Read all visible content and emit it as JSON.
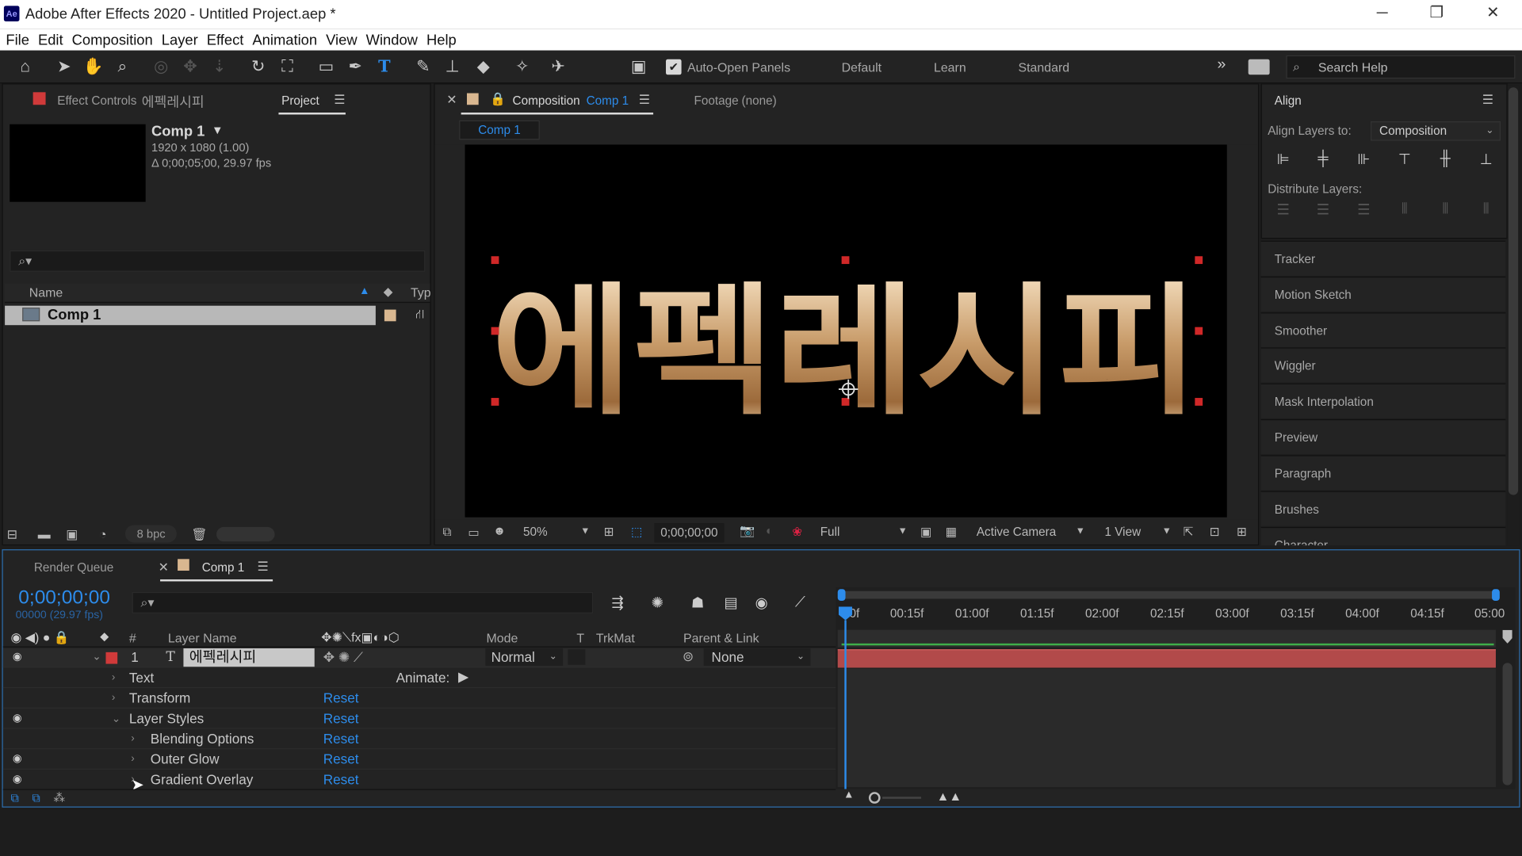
{
  "window": {
    "title": "Adobe After Effects 2020 - Untitled Project.aep *",
    "app_badge": "Ae",
    "minimize": "─",
    "maximize": "❐",
    "close": "✕"
  },
  "menu": [
    "File",
    "Edit",
    "Composition",
    "Layer",
    "Effect",
    "Animation",
    "View",
    "Window",
    "Help"
  ],
  "toolbar": {
    "auto_open": "Auto-Open Panels",
    "workspaces": [
      "Default",
      "Learn",
      "Standard"
    ],
    "more": "»",
    "search_placeholder": "Search Help"
  },
  "left_panel": {
    "tab_effect": "Effect Controls",
    "tab_effect_name": "에펙레시피",
    "tab_project": "Project",
    "comp_name": "Comp 1",
    "comp_size": "1920 x 1080 (1.00)",
    "comp_duration": "Δ 0;00;05;00, 29.97 fps",
    "col_name": "Name",
    "col_type": "Typ",
    "item": "Comp 1",
    "bpc": "8 bpc"
  },
  "viewer": {
    "tab_label": "Composition",
    "tab_comp": "Comp 1",
    "footage": "Footage",
    "footage_val": "(none)",
    "crumb": "Comp 1",
    "text": "에펙레시피",
    "zoom": "50%",
    "timecode": "0;00;00;00",
    "resolution": "Full",
    "camera": "Active Camera",
    "views": "1 View"
  },
  "align": {
    "title": "Align",
    "align_to_label": "Align Layers to:",
    "align_to_value": "Composition",
    "distribute_label": "Distribute Layers:",
    "items": [
      "Tracker",
      "Motion Sketch",
      "Smoother",
      "Wiggler",
      "Mask Interpolation",
      "Preview",
      "Paragraph",
      "Brushes",
      "Character"
    ]
  },
  "timeline": {
    "tab_render": "Render Queue",
    "tab_comp": "Comp 1",
    "timecode": "0;00;00;00",
    "frame_info": "00000 (29.97 fps)",
    "col_num": "#",
    "col_layer": "Layer Name",
    "col_mode": "Mode",
    "col_t": "T",
    "col_trkmat": "TrkMat",
    "col_parent": "Parent & Link",
    "layer_num": "1",
    "layer_name": "에펙레시피",
    "layer_mode": "Normal",
    "layer_parent": "None",
    "animate": "Animate:",
    "ticks": [
      "0f",
      "00:15f",
      "01:00f",
      "01:15f",
      "02:00f",
      "02:15f",
      "03:00f",
      "03:15f",
      "04:00f",
      "04:15f",
      "05:00"
    ],
    "props": [
      {
        "name": "Text",
        "reset": ""
      },
      {
        "name": "Transform",
        "reset": "Reset"
      },
      {
        "name": "Layer Styles",
        "reset": "Reset"
      },
      {
        "name": "Blending Options",
        "reset": "Reset"
      },
      {
        "name": "Outer Glow",
        "reset": "Reset"
      },
      {
        "name": "Gradient Overlay",
        "reset": "Reset"
      }
    ]
  },
  "colors": {
    "accent": "#2d8ceb",
    "layer_bar": "#b24a4a",
    "gold_top": "#f6e1c2",
    "gold_bottom": "#9c6a3b"
  }
}
